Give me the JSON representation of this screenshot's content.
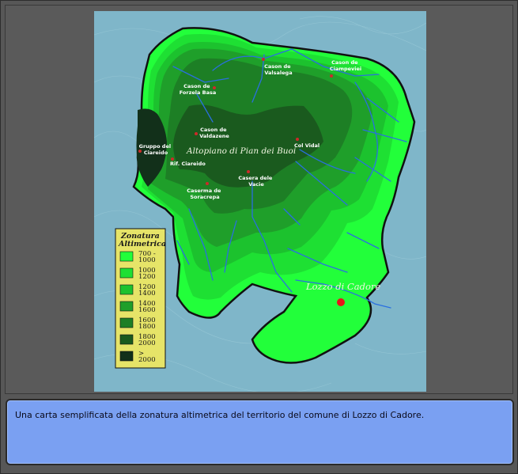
{
  "map": {
    "region_label": "Altopiano di Pian dei Buoi",
    "town_label": "Lozzo di Cadore",
    "places": [
      {
        "lines": [
          "Cason de",
          "Valsalega"
        ]
      },
      {
        "lines": [
          "Cason de",
          "Ciampeviei"
        ]
      },
      {
        "lines": [
          "Cason de",
          "Forzela Basa"
        ]
      },
      {
        "lines": [
          "Cason de",
          "Valdazene"
        ]
      },
      {
        "lines": [
          "Gruppo del",
          "Ciareido"
        ]
      },
      {
        "lines": [
          "Rif. Ciareido"
        ]
      },
      {
        "lines": [
          "Col Vidal"
        ]
      },
      {
        "lines": [
          "Casera dele",
          "Vacie"
        ]
      },
      {
        "lines": [
          "Caserma de",
          "Soracrepa"
        ]
      }
    ],
    "colors": {
      "water_background": "#7fb6c9",
      "zone_700_1000": "#22ff3a",
      "zone_1000_1200": "#1ee033",
      "zone_1200_1400": "#1cc22e",
      "zone_1400_1600": "#1f9f2a",
      "zone_1600_1800": "#1d7f25",
      "zone_1800_2000": "#1a5a1e",
      "zone_over_2000": "#12301a",
      "streams": "#2a6fe0",
      "town_marker": "#e8141a",
      "place_marker": "#cc2a2a"
    }
  },
  "legend": {
    "title_line1": "Zonatura",
    "title_line2": "Altimetrica",
    "entries": [
      {
        "line1": "700 -",
        "line2": "1000",
        "color": "#22ff3a"
      },
      {
        "line1": "1000",
        "line2": "1200",
        "color": "#1ee033"
      },
      {
        "line1": "1200",
        "line2": "1400",
        "color": "#1cc22e"
      },
      {
        "line1": "1400",
        "line2": "1600",
        "color": "#1f9f2a"
      },
      {
        "line1": "1600",
        "line2": "1800",
        "color": "#1d7f25"
      },
      {
        "line1": "1800",
        "line2": "2000",
        "color": "#1a5a1e"
      },
      {
        "line1": ">",
        "line2": "2000",
        "color": "#12301a"
      }
    ]
  },
  "caption": "Una carta semplificata della zonatura altimetrica del territorio del comune di Lozzo di Cadore."
}
